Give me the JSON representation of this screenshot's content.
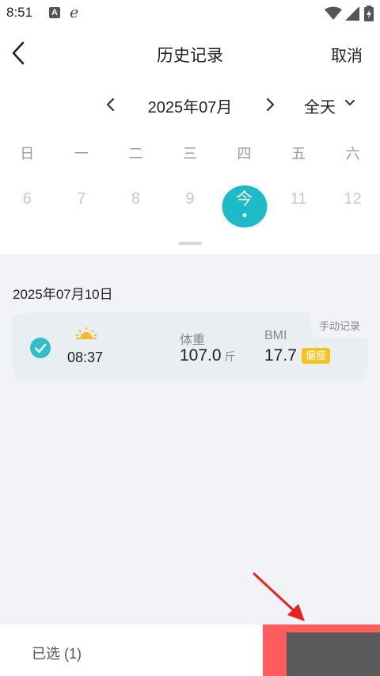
{
  "status_bar": {
    "time": "8:51",
    "badge_letter": "A",
    "browser_glyph": "e"
  },
  "header": {
    "title": "历史记录",
    "cancel_label": "取消",
    "back_icon": "chevron-left-icon"
  },
  "calendar": {
    "month_label": "2025年07月",
    "range_label": "全天",
    "weekdays": [
      "日",
      "一",
      "二",
      "三",
      "四",
      "五",
      "六"
    ],
    "days": [
      "6",
      "7",
      "8",
      "9",
      "今",
      "11",
      "12"
    ],
    "today_index": 4,
    "accent_color": "#1dbac8"
  },
  "records": {
    "date_heading": "2025年07月10日",
    "items": [
      {
        "selected": true,
        "period_icon": "sunrise-icon",
        "time": "08:37",
        "weight_label": "体重",
        "weight_value": "107.0",
        "weight_unit": "斤",
        "bmi_label": "BMI",
        "bmi_value": "17.7",
        "bmi_status": "偏瘦",
        "source_tag": "手动记录"
      }
    ]
  },
  "bottom_bar": {
    "selected_label": "已选 (1)",
    "action_color": "#ff5c5c"
  },
  "annotation": {
    "arrow_color": "#e8221f"
  }
}
